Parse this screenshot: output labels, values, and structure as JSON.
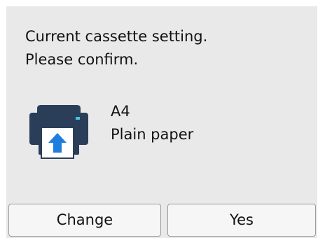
{
  "message": {
    "line1": "Current cassette setting.",
    "line2": "Please confirm."
  },
  "setting": {
    "paper_size": "A4",
    "paper_type": "Plain paper"
  },
  "icon": {
    "name": "printer-paper-feed-icon",
    "body_color": "#2b3e59",
    "arrow_color": "#1f7de0",
    "indicator_color": "#44c3e6"
  },
  "buttons": {
    "change_label": "Change",
    "yes_label": "Yes"
  }
}
